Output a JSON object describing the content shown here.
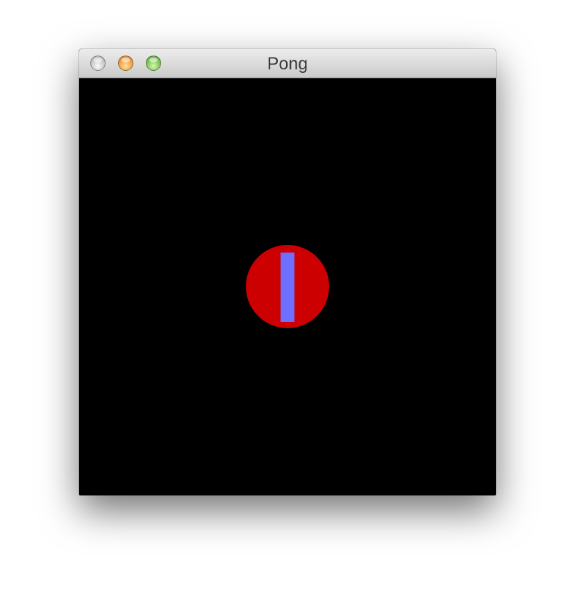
{
  "window": {
    "title": "Pong"
  },
  "game": {
    "background_color": "#000000",
    "ball": {
      "color": "#cc0000"
    },
    "paddle": {
      "color": "#6f6fff"
    }
  },
  "icons": {
    "close": "close-icon",
    "minimize": "minimize-icon",
    "zoom": "zoom-icon"
  }
}
